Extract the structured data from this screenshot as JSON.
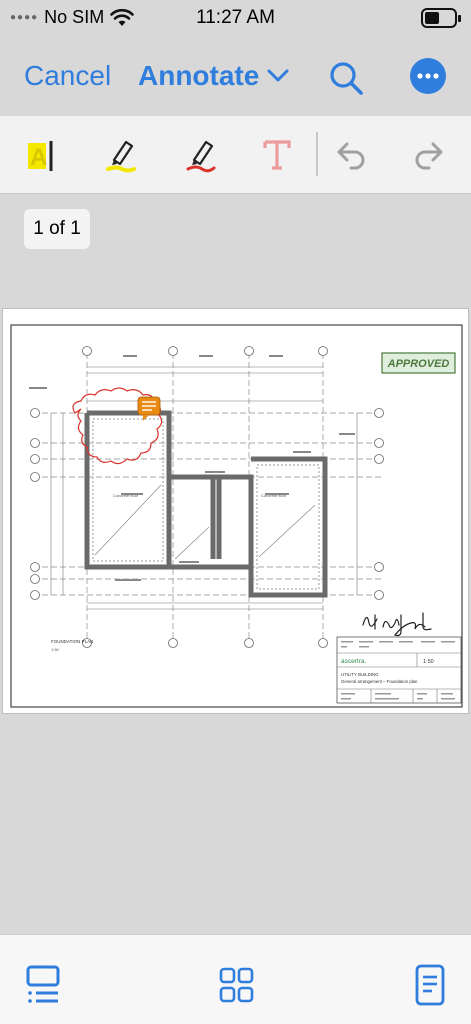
{
  "status_bar": {
    "carrier": "No SIM",
    "time": "11:27 AM"
  },
  "nav": {
    "cancel_label": "Cancel",
    "title": "Annotate"
  },
  "page_indicator": "1 of 1",
  "document": {
    "stamp": "APPROVED",
    "plan_label": "FOUNDATION PLAN",
    "plan_scale": "1:50",
    "room_label_left": "Concrete floor",
    "room_label_right": "Concrete floor",
    "title_block": {
      "company": "ascertra.",
      "scale": "1:50",
      "project": "UTILITY BUILDING",
      "drawing_title": "General arrangement – Foundation plan"
    }
  },
  "colors": {
    "accent": "#2f7ddc",
    "highlight": "#f5e800",
    "ink_red": "#d9332c",
    "stamp_green": "#4c7a3e",
    "comment_orange": "#e98a14"
  }
}
